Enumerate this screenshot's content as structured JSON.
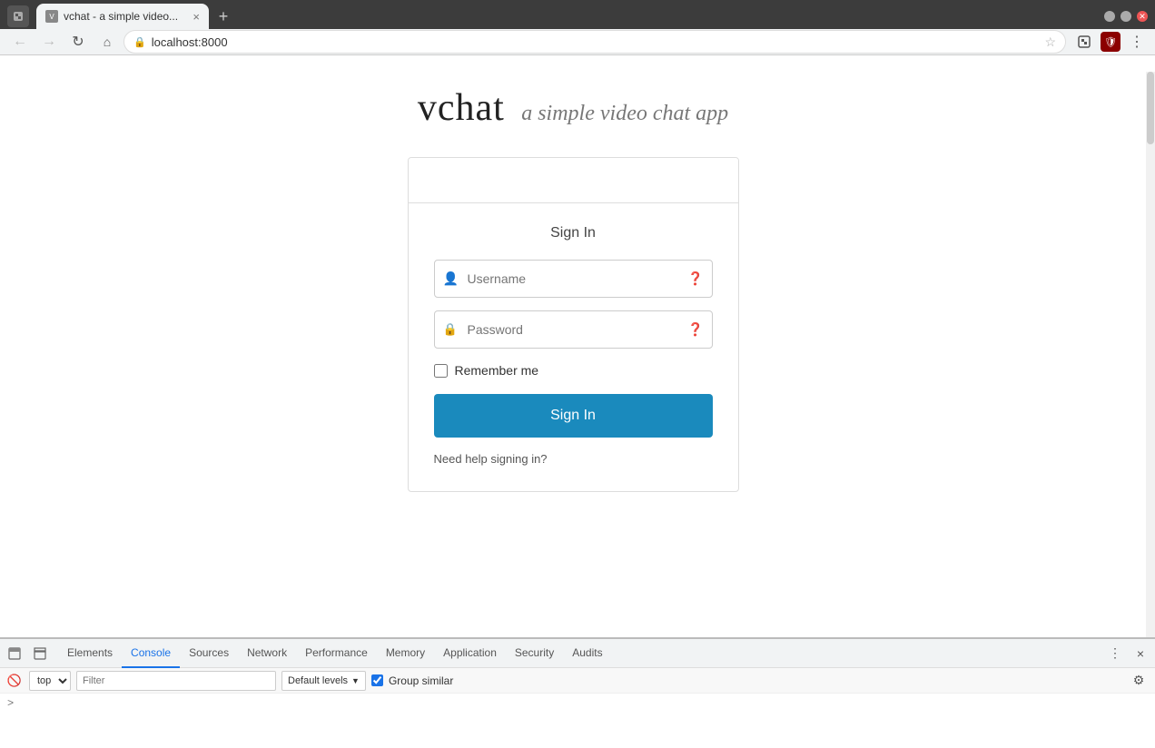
{
  "browser": {
    "tab_title": "vchat - a simple video...",
    "tab_close": "×",
    "new_tab": "+",
    "address": "localhost:8000",
    "back_label": "←",
    "forward_label": "→",
    "reload_label": "↻",
    "home_label": "⌂",
    "star_label": "☆",
    "close_label": "×",
    "menu_label": "⋮"
  },
  "page": {
    "title_main": "vchat",
    "title_sub": "a simple video chat app",
    "card_header": "",
    "sign_in_heading": "Sign In",
    "username_placeholder": "Username",
    "password_placeholder": "Password",
    "remember_me_label": "Remember me",
    "sign_in_button": "Sign In",
    "help_link": "Need help signing in?"
  },
  "devtools": {
    "tabs": [
      {
        "label": "Elements",
        "active": false
      },
      {
        "label": "Console",
        "active": true
      },
      {
        "label": "Sources",
        "active": false
      },
      {
        "label": "Network",
        "active": false
      },
      {
        "label": "Performance",
        "active": false
      },
      {
        "label": "Memory",
        "active": false
      },
      {
        "label": "Application",
        "active": false
      },
      {
        "label": "Security",
        "active": false
      },
      {
        "label": "Audits",
        "active": false
      }
    ],
    "context_selector": "top",
    "filter_placeholder": "Filter",
    "levels_label": "Default levels",
    "group_similar_label": "Group similar",
    "group_similar_checked": true,
    "settings_icon": "⚙",
    "more_icon": "⋮",
    "close_icon": "×",
    "dock_icon": "▣",
    "undock_icon": "⊡",
    "no_errors_icon": "🚫",
    "console_arrow": ">"
  }
}
